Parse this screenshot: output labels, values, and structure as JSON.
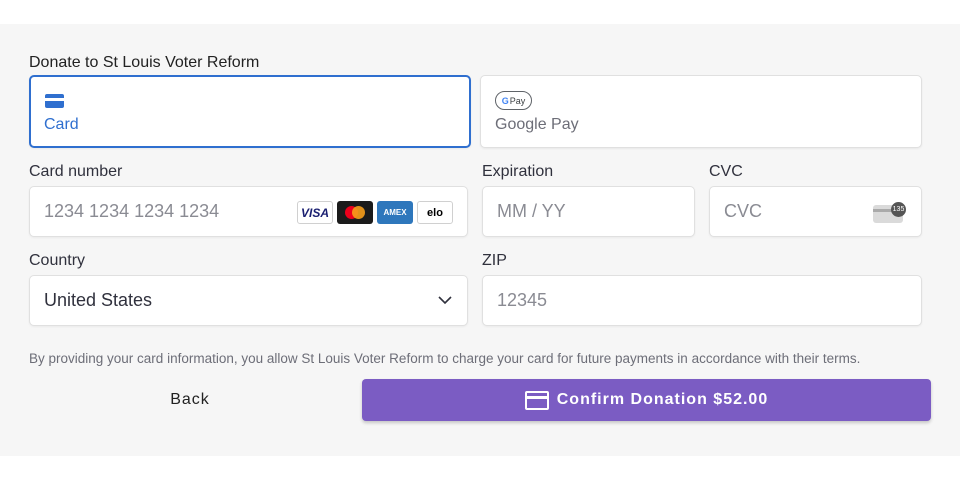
{
  "form": {
    "heading": "Donate to St Louis Voter Reform",
    "methods": [
      {
        "label": "Card",
        "icon": "credit-card-icon",
        "selected": true
      },
      {
        "label": "Google Pay",
        "icon": "google-pay-icon",
        "badge": "Pay",
        "selected": false
      }
    ],
    "card_number": {
      "label": "Card number",
      "placeholder": "1234 1234 1234 1234",
      "brands": [
        "VISA",
        "mastercard",
        "AMEX",
        "elo"
      ]
    },
    "expiration": {
      "label": "Expiration",
      "placeholder": "MM / YY"
    },
    "cvc": {
      "label": "CVC",
      "placeholder": "CVC",
      "hint": "135"
    },
    "country": {
      "label": "Country",
      "value": "United States"
    },
    "zip": {
      "label": "ZIP",
      "placeholder": "12345"
    },
    "terms": "By providing your card information, you allow St Louis Voter Reform to charge your card for future payments in accordance with their terms.",
    "back_label": "Back",
    "confirm_label": "Confirm Donation $52.00"
  },
  "colors": {
    "accent": "#2f6fcf",
    "confirm": "#7b5cc3",
    "panel": "#f6f6f6"
  }
}
